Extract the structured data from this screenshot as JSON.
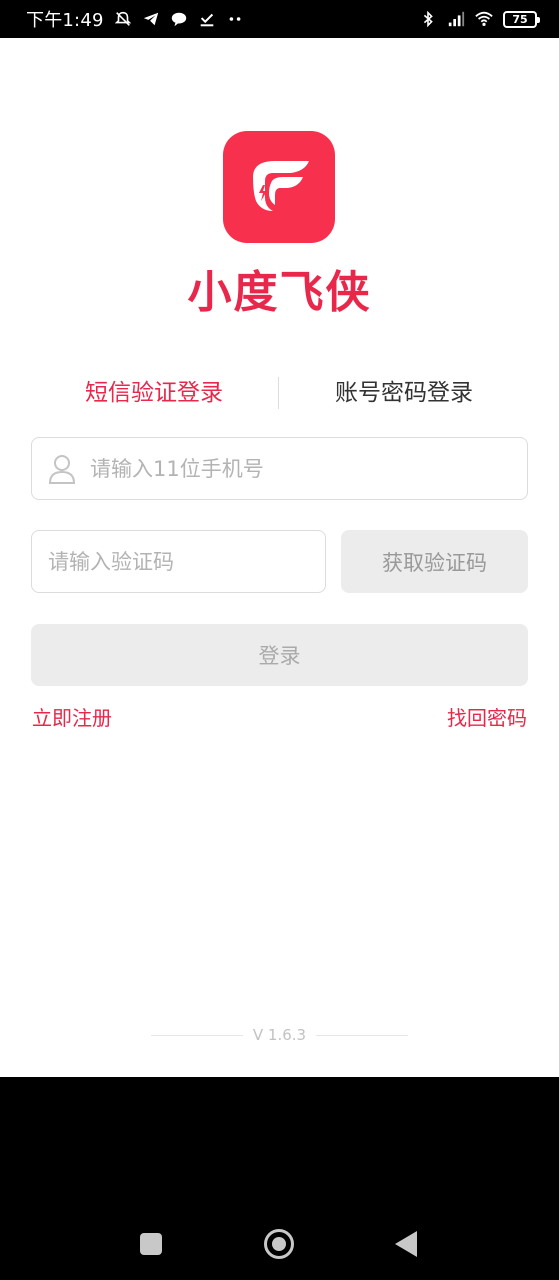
{
  "status_bar": {
    "time": "下午1:49",
    "battery": "75",
    "icons": [
      "mute-icon",
      "telegram-icon",
      "chat-bubble-icon",
      "download-done-icon",
      "more-dots-icon",
      "bluetooth-icon",
      "signal-icon",
      "wifi-icon",
      "battery-icon"
    ]
  },
  "brand": {
    "name": "小度飞侠",
    "color": "#e8274a",
    "logo_color": "#f7304d"
  },
  "tabs": [
    {
      "label": "短信验证登录",
      "active": true
    },
    {
      "label": "账号密码登录",
      "active": false
    }
  ],
  "form": {
    "phone_placeholder": "请输入11位手机号",
    "phone_value": "",
    "code_placeholder": "请输入验证码",
    "code_value": "",
    "get_code_label": "获取验证码",
    "login_label": "登录"
  },
  "links": {
    "register": "立即注册",
    "forgot_password": "找回密码"
  },
  "version": "V 1.6.3"
}
